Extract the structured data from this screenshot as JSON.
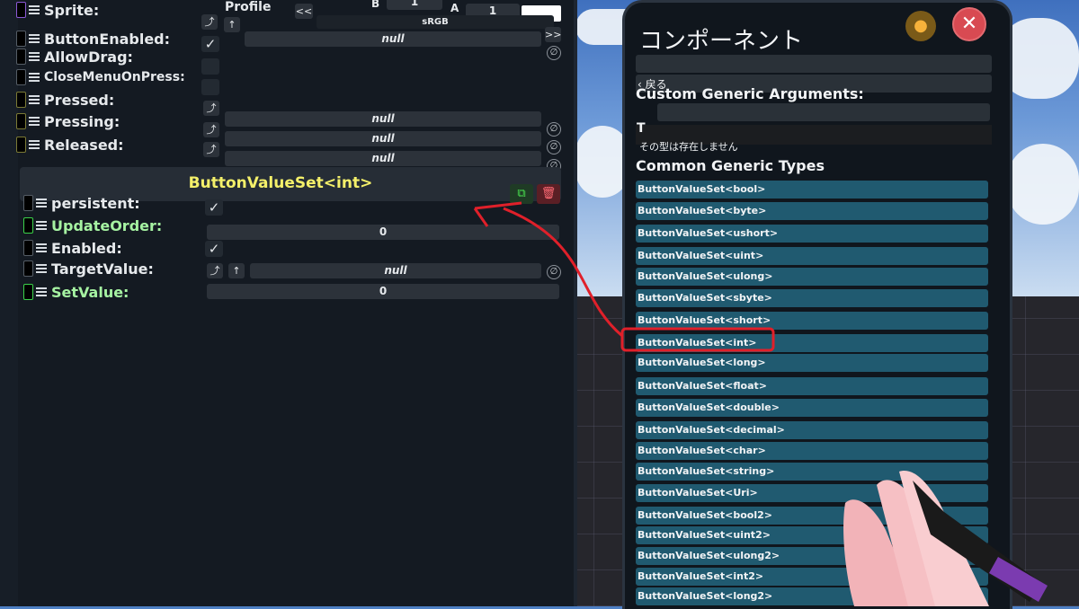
{
  "inspector": {
    "top": {
      "profile_label": "Profile",
      "b_label": "B",
      "a_label": "A",
      "b_value": "1",
      "a_value": "1",
      "scroll_left": "<<",
      "colorspace": "sRGB",
      "scroll_right": ">>"
    },
    "rows": [
      {
        "label": "Sprite:"
      },
      {
        "label": "ButtonEnabled:"
      },
      {
        "label": "AllowDrag:"
      },
      {
        "label": "CloseMenuOnPress:"
      },
      {
        "label": "Pressed:"
      },
      {
        "label": "Pressing:"
      },
      {
        "label": "Released:"
      }
    ],
    "null_text": "null",
    "component_header": "ButtonValueSet<int>",
    "component_rows": [
      {
        "label": "persistent:"
      },
      {
        "label": "UpdateOrder:",
        "value": "0"
      },
      {
        "label": "Enabled:"
      },
      {
        "label": "TargetValue:"
      },
      {
        "label": "SetValue:",
        "value": "0"
      }
    ],
    "icons": {
      "jump": "⤴",
      "up": "↑",
      "check": "✓",
      "clear": "∅",
      "copy": "⧉",
      "trash": "🗑"
    }
  },
  "component_panel": {
    "title": "コンポーネント",
    "back_label": "‹ 戻る",
    "custom_generic_label": "Custom Generic Arguments:",
    "t_label": "T",
    "error_text": "その型は存在しません",
    "common_generic_label": "Common Generic Types",
    "types": [
      "ButtonValueSet<bool>",
      "ButtonValueSet<byte>",
      "ButtonValueSet<ushort>",
      "ButtonValueSet<uint>",
      "ButtonValueSet<ulong>",
      "ButtonValueSet<sbyte>",
      "ButtonValueSet<short>",
      "ButtonValueSet<int>",
      "ButtonValueSet<long>",
      "ButtonValueSet<float>",
      "ButtonValueSet<double>",
      "ButtonValueSet<decimal>",
      "ButtonValueSet<char>",
      "ButtonValueSet<string>",
      "ButtonValueSet<Uri>",
      "ButtonValueSet<bool2>",
      "ButtonValueSet<uint2>",
      "ButtonValueSet<ulong2>",
      "ButtonValueSet<int2>",
      "ButtonValueSet<long2>"
    ],
    "icons": {
      "pin": "location-pin-icon",
      "close": "close-icon"
    }
  },
  "colors": {
    "highlight_annotation": "#e0202a",
    "header_text": "#f4f06a",
    "type_button": "#205a70"
  }
}
